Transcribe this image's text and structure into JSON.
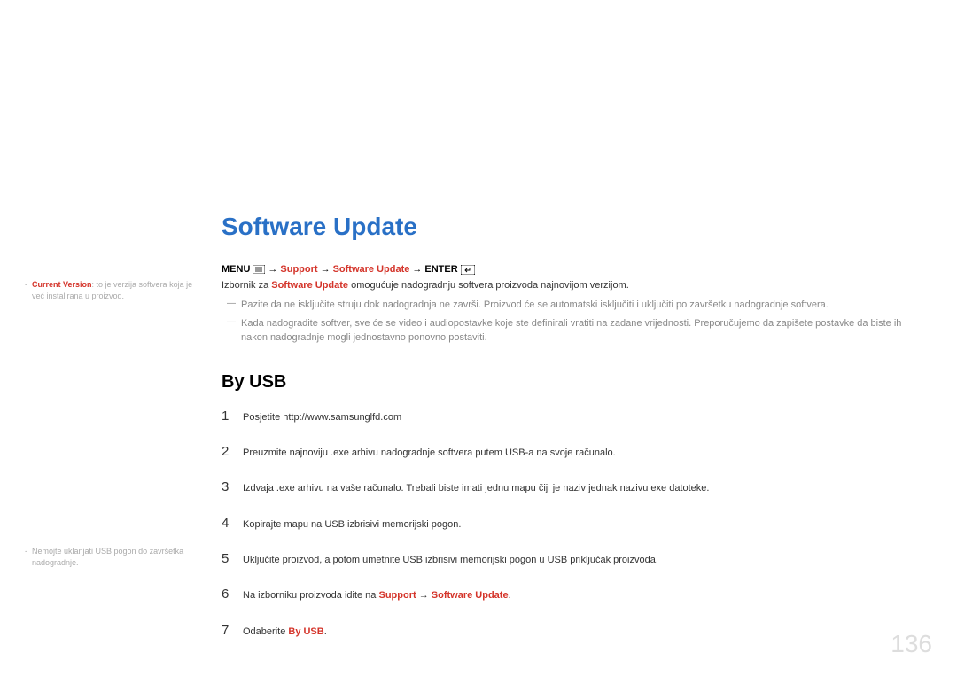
{
  "title": "Software Update",
  "nav": {
    "menu_label": "MENU",
    "support": "Support",
    "software_update": "Software Update",
    "enter": "ENTER"
  },
  "intro": {
    "prefix": "Izbornik za ",
    "highlight": "Software Update",
    "suffix": " omogućuje nadogradnju softvera proizvoda najnovijom verzijom."
  },
  "dash_notes": [
    "Pazite da ne isključite struju dok nadogradnja ne završi. Proizvod će se automatski isključiti i uključiti po završetku nadogradnje softvera.",
    "Kada nadogradite softver, sve će se video i audiopostavke koje ste definirali vratiti na zadane vrijednosti. Preporučujemo da zapišete postavke da biste ih nakon nadogradnje mogli jednostavno ponovno postaviti."
  ],
  "section_title": "By USB",
  "steps": [
    {
      "num": "1",
      "text": "Posjetite http://www.samsunglfd.com"
    },
    {
      "num": "2",
      "text": "Preuzmite najnoviju .exe arhivu nadogradnje softvera putem USB-a na svoje računalo."
    },
    {
      "num": "3",
      "text": "Izdvaja .exe arhivu na vaše računalo. Trebali biste imati jednu mapu čiji je naziv jednak nazivu exe datoteke."
    },
    {
      "num": "4",
      "text": "Kopirajte mapu na USB izbrisivi memorijski pogon."
    },
    {
      "num": "5",
      "text": "Uključite proizvod, a potom umetnite USB izbrisivi memorijski pogon u USB priključak proizvoda."
    }
  ],
  "step6": {
    "num": "6",
    "prefix": "Na izborniku proizvoda idite na ",
    "support": "Support",
    "arrow": " → ",
    "software_update": "Software Update",
    "suffix": "."
  },
  "step7": {
    "num": "7",
    "prefix": "Odaberite ",
    "highlight": "By USB",
    "suffix": "."
  },
  "sidebar_notes": {
    "note1": {
      "highlight": "Current Version",
      "rest": ": to je verzija softvera koja je već instalirana u proizvod."
    },
    "note2": "Nemojte uklanjati USB pogon do završetka nadogradnje."
  },
  "page_number": "136"
}
